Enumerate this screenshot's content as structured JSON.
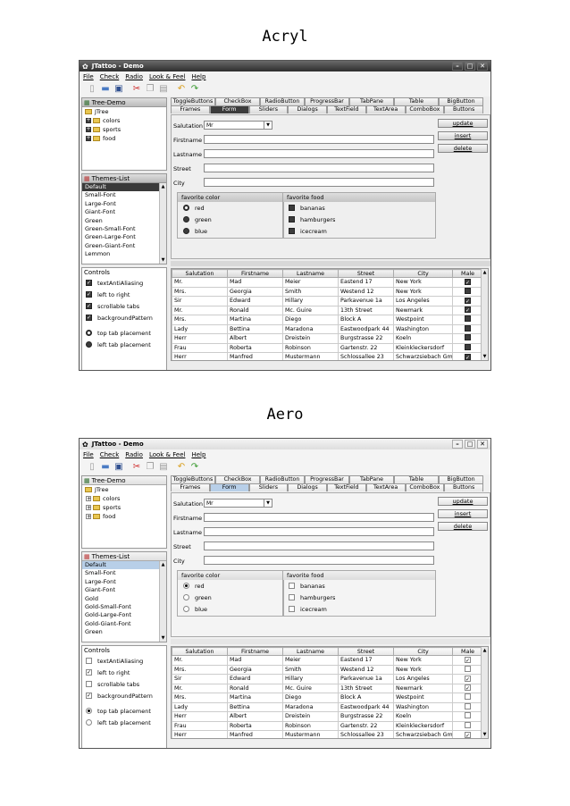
{
  "themes": [
    {
      "key": "acryl",
      "caption": "Acryl",
      "window_title": "JTattoo - Demo",
      "themes_list": [
        "Default",
        "Small-Font",
        "Large-Font",
        "Giant-Font",
        "Green",
        "Green-Small-Font",
        "Green-Large-Font",
        "Green-Giant-Font",
        "Lemmon"
      ],
      "controls_checked": [
        true,
        true,
        true,
        true
      ],
      "radio_selected": 0
    },
    {
      "key": "aero",
      "caption": "Aero",
      "window_title": "JTattoo - Demo",
      "themes_list": [
        "Default",
        "Small-Font",
        "Large-Font",
        "Giant-Font",
        "Gold",
        "Gold-Small-Font",
        "Gold-Large-Font",
        "Gold-Giant-Font",
        "Green"
      ],
      "controls_checked": [
        false,
        true,
        false,
        true
      ],
      "radio_selected": 0
    }
  ],
  "menu": [
    "File",
    "Check",
    "Radio",
    "Look & Feel",
    "Help"
  ],
  "toolbar_icons": [
    "new-file-icon",
    "open-folder-icon",
    "save-icon",
    "cut-icon",
    "copy-icon",
    "paste-icon",
    "undo-icon",
    "redo-icon"
  ],
  "tree": {
    "header": "Tree-Demo",
    "root": "JTree",
    "children": [
      "colors",
      "sports",
      "food"
    ]
  },
  "themes_header": "Themes-List",
  "controls": {
    "header": "Controls",
    "checkboxes": [
      "textAntiAliasing",
      "left to right",
      "scrollable tabs",
      "backgroundPattern"
    ],
    "radios": [
      "top tab placement",
      "left tab placement"
    ]
  },
  "tabs_row1": [
    "ToggleButtons",
    "CheckBox",
    "RadioButton",
    "ProgressBar",
    "TabPane",
    "Table",
    "BigButton"
  ],
  "tabs_row2": [
    "Frames",
    "Form",
    "Sliders",
    "Dialogs",
    "TextField",
    "TextArea",
    "ComboBox",
    "Buttons"
  ],
  "selected_tab": "Form",
  "form": {
    "salutation_label": "Salutation",
    "salutation_value": "Mr",
    "firstname_label": "Firstname",
    "lastname_label": "Lastname",
    "street_label": "Street",
    "city_label": "City",
    "buttons": [
      "update",
      "insert",
      "delete"
    ],
    "color_group": {
      "title": "favorite color",
      "items": [
        "red",
        "green",
        "blue"
      ],
      "selected": 0
    },
    "food_group": {
      "title": "favorite food",
      "items": [
        "bananas",
        "hamburgers",
        "icecream"
      ]
    }
  },
  "table": {
    "columns": [
      "Salutation",
      "Firstname",
      "Lastname",
      "Street",
      "City",
      "Male"
    ],
    "rows": [
      [
        "Mr.",
        "Mad",
        "Meier",
        "Eastend 17",
        "New York",
        true
      ],
      [
        "Mrs.",
        "Georgia",
        "Smith",
        "Westend 12",
        "New York",
        false
      ],
      [
        "Sir",
        "Edward",
        "Hillary",
        "Parkavenue 1a",
        "Los Angeles",
        true
      ],
      [
        "Mr.",
        "Ronald",
        "Mc. Guire",
        "13th Street",
        "Newmark",
        true
      ],
      [
        "Mrs.",
        "Martina",
        "Diego",
        "Block A",
        "Westpoint",
        false
      ],
      [
        "Lady",
        "Bettina",
        "Maradona",
        "Eastwoodpark 44",
        "Washington",
        false
      ],
      [
        "Herr",
        "Albert",
        "Dreistein",
        "Burgstrasse 22",
        "Koeln",
        false
      ],
      [
        "Frau",
        "Roberta",
        "Robinson",
        "Gartenstr. 22",
        "Kleinkleckersdorf",
        false
      ],
      [
        "Herr",
        "Manfred",
        "Mustermann",
        "Schlossallee 23",
        "Schwarzsiebach Gmb",
        true
      ]
    ]
  },
  "colors": {
    "acryl_accent": "#3c3c3c",
    "aero_accent": "#b8cfe8"
  }
}
